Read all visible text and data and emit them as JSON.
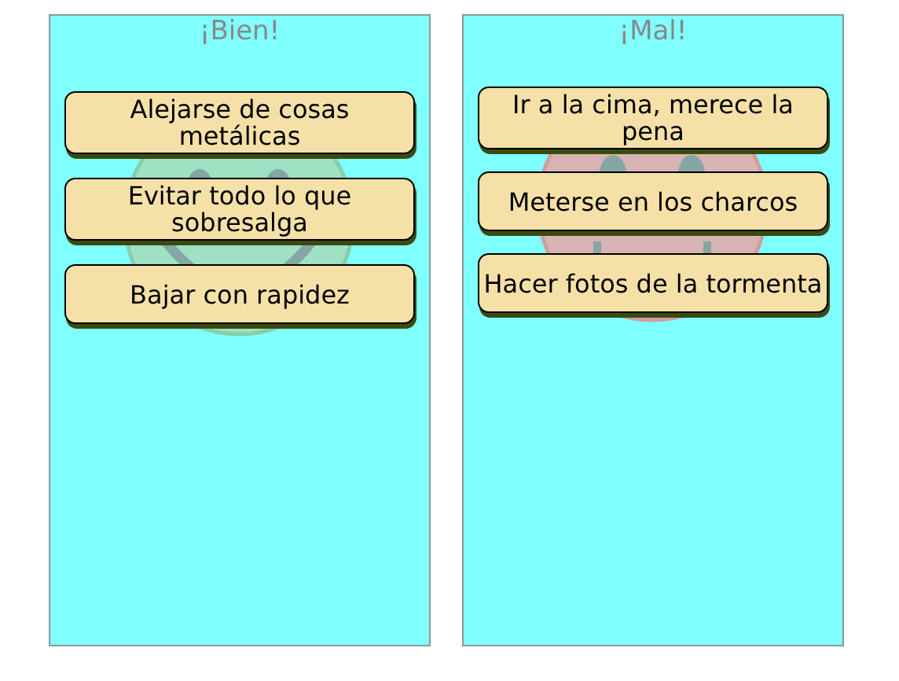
{
  "columns": [
    {
      "title": "¡Bien!",
      "kind": "happy",
      "items": [
        "Alejarse de cosas metálicas",
        "Evitar todo lo que sobresalga",
        "Bajar con rapidez"
      ]
    },
    {
      "title": "¡Mal!",
      "kind": "sad",
      "items": [
        "Ir a la cima, merece la pena",
        "Meterse en los charcos",
        "Hacer fotos de la tormenta"
      ]
    }
  ]
}
